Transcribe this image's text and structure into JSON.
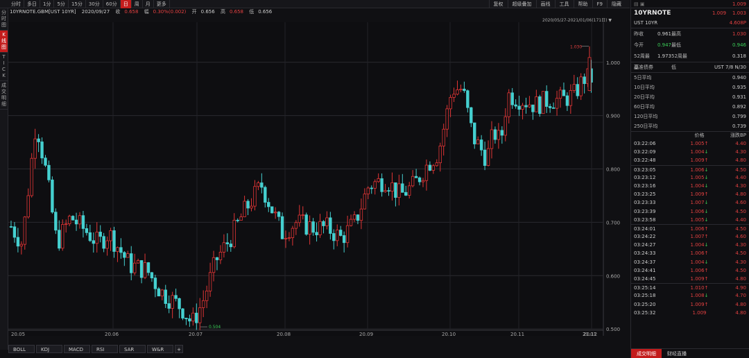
{
  "toolbar": {
    "periods": [
      "分时",
      "多日",
      "1分",
      "5分",
      "15分",
      "30分",
      "60分",
      "日",
      "周",
      "月",
      "更多"
    ],
    "active_period": "日",
    "tools": [
      "复权",
      "超级叠加",
      "画线",
      "工具",
      "帮助",
      "F9",
      "隐藏"
    ]
  },
  "left_tabs": [
    {
      "chars": [
        "分",
        "时",
        "图"
      ],
      "active": false
    },
    {
      "chars": [
        "K",
        "线",
        "图"
      ],
      "active": true
    },
    {
      "chars": [
        "T",
        "I",
        "C",
        "K"
      ],
      "active": false
    },
    {
      "chars": [
        "成",
        "交",
        "明",
        "细"
      ],
      "active": false
    }
  ],
  "info": {
    "symbol": "10YRNOTE.GBM[UST 10YR]",
    "date": "2020/09/27",
    "close_label": "收",
    "close": "0.658",
    "change_label": "幅",
    "change": "0.30%(0.002)",
    "open_label": "开",
    "open": "0.656",
    "high_label": "高",
    "high": "0.658",
    "low_label": "低",
    "low": "0.656"
  },
  "range": "2020/05/27-2021/01/06(171日)",
  "chart_data": {
    "type": "candlestick",
    "y_ticks": [
      "1.000",
      "0.900",
      "0.800",
      "0.700",
      "0.600",
      "0.500"
    ],
    "x_labels": [
      "20.05",
      "20.06",
      "20.07",
      "20.08",
      "20.09",
      "20.10",
      "20.11",
      "20.12",
      "21.01"
    ],
    "max_label": "1.030",
    "min_label": "0.504",
    "up_color": "#e23535",
    "down_color": "#45d0d0"
  },
  "bottom_tabs": [
    "BOLL",
    "KDJ",
    "MACD",
    "RSI",
    "SAR",
    "W&R",
    "+"
  ],
  "quote": {
    "symbol": "10YRNOTE",
    "name": "UST 10YR",
    "last": "1.009",
    "bid": "1.009",
    "ask": "1.003",
    "change": "4.608P",
    "stats": [
      [
        "昨收",
        "0.961",
        "最高",
        "1.030"
      ],
      [
        "今开",
        "0.947",
        "最低",
        "0.946"
      ],
      [
        "52周最高",
        "1.973",
        "52周最低",
        "0.318"
      ]
    ],
    "bond_label": "基准债券",
    "bond_value": "UST 7/8 N/30",
    "ma": [
      [
        "5日平均",
        "0.940"
      ],
      [
        "10日平均",
        "0.935"
      ],
      [
        "20日平均",
        "0.931"
      ],
      [
        "60日平均",
        "0.892"
      ],
      [
        "120日平均",
        "0.799"
      ],
      [
        "250日平均",
        "0.739"
      ]
    ],
    "tick_headers": [
      "价格",
      "涨跌BP"
    ],
    "ticks": [
      [
        "03:22:06",
        "1.005↑",
        "4.40"
      ],
      [
        "03:22:09",
        "1.004↓",
        "4.30"
      ],
      [
        "03:22:48",
        "1.009↑",
        "4.80"
      ],
      [
        "03:23:05",
        "1.006↓",
        "4.50"
      ],
      [
        "03:23:12",
        "1.005↓",
        "4.40"
      ],
      [
        "03:23:16",
        "1.004↓",
        "4.30"
      ],
      [
        "03:23:25",
        "1.009↑",
        "4.80"
      ],
      [
        "03:23:33",
        "1.007↓",
        "4.60"
      ],
      [
        "03:23:39",
        "1.006↓",
        "4.50"
      ],
      [
        "03:23:58",
        "1.005↓",
        "4.40"
      ],
      [
        "03:24:01",
        "1.006↑",
        "4.50"
      ],
      [
        "03:24:22",
        "1.007↑",
        "4.60"
      ],
      [
        "03:24:27",
        "1.004↓",
        "4.30"
      ],
      [
        "03:24:33",
        "1.006↑",
        "4.50"
      ],
      [
        "03:24:37",
        "1.004↓",
        "4.30"
      ],
      [
        "03:24:41",
        "1.006↑",
        "4.50"
      ],
      [
        "03:24:45",
        "1.009↑",
        "4.80"
      ],
      [
        "03:25:14",
        "1.010↑",
        "4.90"
      ],
      [
        "03:25:18",
        "1.008↓",
        "4.70"
      ],
      [
        "03:25:20",
        "1.009↑",
        "4.80"
      ],
      [
        "03:25:32",
        "1.009",
        "4.80"
      ]
    ],
    "bottom_tabs": [
      "成交明细",
      "财经直播"
    ]
  }
}
